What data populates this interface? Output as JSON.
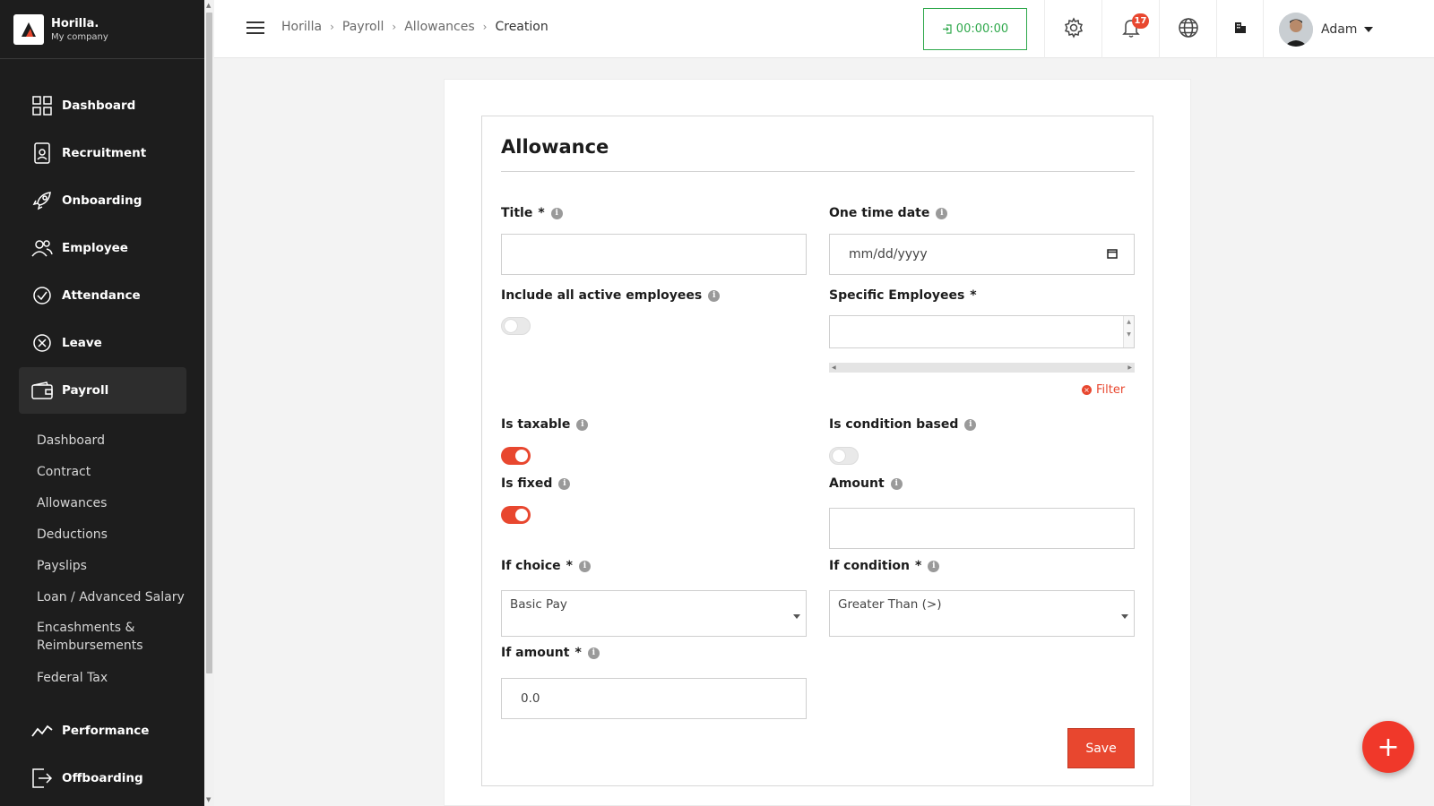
{
  "brand": {
    "name": "Horilla.",
    "company": "My company"
  },
  "sidebar": {
    "items": [
      {
        "label": "Dashboard",
        "icon": "dashboard-grid-icon"
      },
      {
        "label": "Recruitment",
        "icon": "recruitment-icon"
      },
      {
        "label": "Onboarding",
        "icon": "rocket-icon"
      },
      {
        "label": "Employee",
        "icon": "people-icon"
      },
      {
        "label": "Attendance",
        "icon": "check-circle-icon"
      },
      {
        "label": "Leave",
        "icon": "x-circle-icon"
      },
      {
        "label": "Payroll",
        "icon": "wallet-icon",
        "active": true
      },
      {
        "label": "Performance",
        "icon": "trend-line-icon"
      },
      {
        "label": "Offboarding",
        "icon": "exit-icon"
      }
    ],
    "payroll_sub": [
      "Dashboard",
      "Contract",
      "Allowances",
      "Deductions",
      "Payslips",
      "Loan / Advanced Salary",
      "Encashments & Reimbursements",
      "Federal Tax"
    ]
  },
  "header": {
    "breadcrumb": [
      "Horilla",
      "Payroll",
      "Allowances",
      "Creation"
    ],
    "timer": "00:00:00",
    "notification_count": "17",
    "user_name": "Adam"
  },
  "form": {
    "title": "Allowance",
    "fields": {
      "title_label": "Title",
      "one_time_date_label": "One time date",
      "one_time_date_placeholder": "mm/dd/yyyy",
      "include_all_label": "Include all active employees",
      "specific_employees_label": "Specific Employees",
      "filter_label": "Filter",
      "is_taxable_label": "Is taxable",
      "is_condition_based_label": "Is condition based",
      "is_fixed_label": "Is fixed",
      "amount_label": "Amount",
      "if_choice_label": "If choice",
      "if_choice_value": "Basic Pay",
      "if_condition_label": "If condition",
      "if_condition_value": "Greater Than (>)",
      "if_amount_label": "If amount",
      "if_amount_value": "0.0"
    },
    "toggles": {
      "include_all": false,
      "is_taxable": true,
      "is_condition_based": false,
      "is_fixed": true
    },
    "save_label": "Save"
  },
  "colors": {
    "accent": "#e8472f",
    "timer_green": "#2ea84b",
    "sidebar_bg": "#1d1d1d"
  }
}
